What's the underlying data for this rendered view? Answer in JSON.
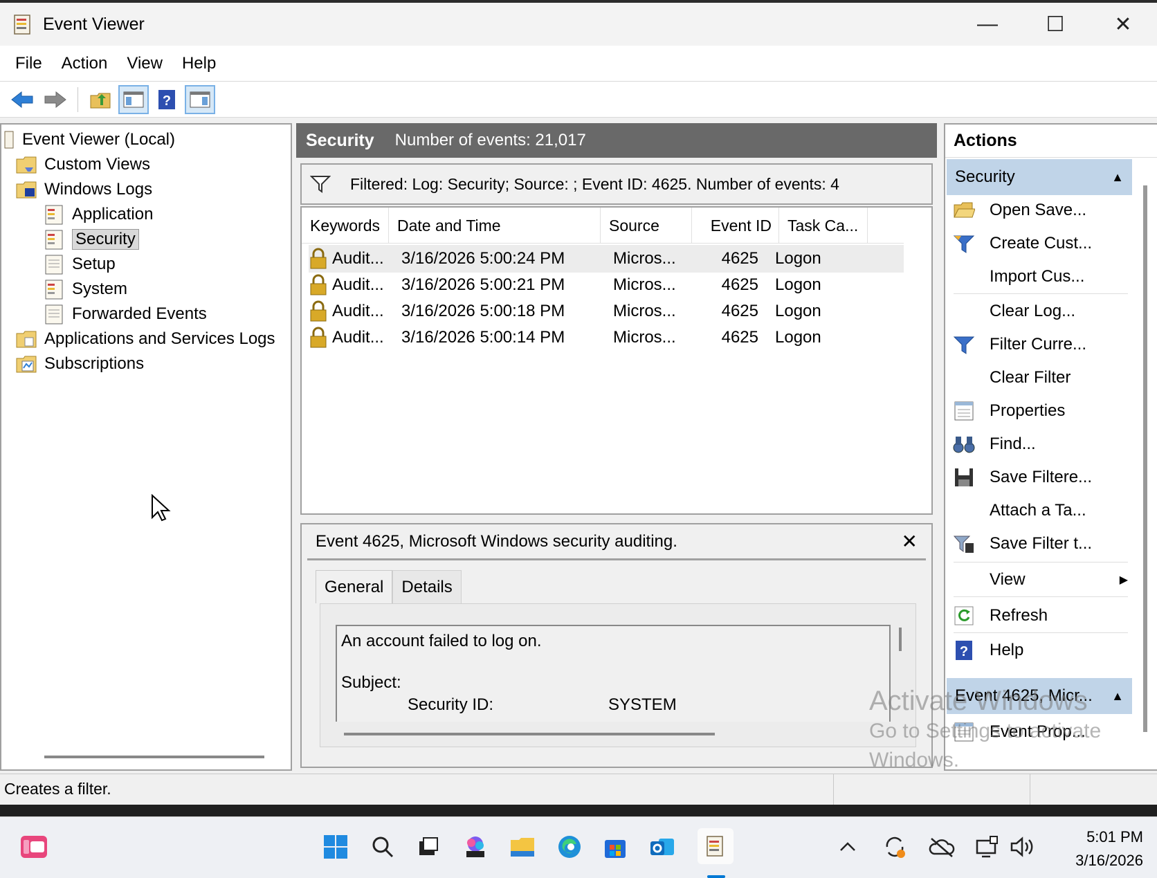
{
  "window": {
    "title": "Event Viewer",
    "controls": {
      "minimize": "—",
      "maximize": "☐",
      "close": "✕"
    }
  },
  "menu": [
    "File",
    "Action",
    "View",
    "Help"
  ],
  "toolbar": {
    "buttons": [
      "back-arrow-icon",
      "forward-arrow-icon",
      "up-folder-icon",
      "show-hide-console-tree-icon",
      "help-icon",
      "show-hide-action-pane-icon"
    ]
  },
  "tree": {
    "items": [
      {
        "label": "Event Viewer (Local)"
      },
      {
        "label": "Custom Views"
      },
      {
        "label": "Windows Logs"
      },
      {
        "label": "Application"
      },
      {
        "label": "Security"
      },
      {
        "label": "Setup"
      },
      {
        "label": "System"
      },
      {
        "label": "Forwarded Events"
      },
      {
        "label": "Applications and Services Logs"
      },
      {
        "label": "Subscriptions"
      }
    ]
  },
  "main": {
    "log_name": "Security",
    "event_count": "Number of events: 21,017",
    "filter_text": "Filtered: Log: Security; Source: ; Event ID: 4625. Number of events: 4",
    "columns": [
      "Keywords",
      "Date and Time",
      "Source",
      "Event ID",
      "Task Ca..."
    ],
    "rows": [
      {
        "keywords": "Audit...",
        "date": "3/16/2026 5:00:24 PM",
        "source": "Micros...",
        "event_id": "4625",
        "task": "Logon"
      },
      {
        "keywords": "Audit...",
        "date": "3/16/2026 5:00:21 PM",
        "source": "Micros...",
        "event_id": "4625",
        "task": "Logon"
      },
      {
        "keywords": "Audit...",
        "date": "3/16/2026 5:00:18 PM",
        "source": "Micros...",
        "event_id": "4625",
        "task": "Logon"
      },
      {
        "keywords": "Audit...",
        "date": "3/16/2026 5:00:14 PM",
        "source": "Micros...",
        "event_id": "4625",
        "task": "Logon"
      }
    ]
  },
  "detail": {
    "title": "Event 4625, Microsoft Windows security auditing.",
    "close": "✕",
    "tabs": [
      "General",
      "Details"
    ],
    "line1": "An account failed to log on.",
    "line2": "Subject:",
    "field_label": "Security ID:",
    "field_value": "SYSTEM"
  },
  "actions": {
    "title": "Actions",
    "section1": "Security",
    "items": [
      {
        "label": "Open Save...",
        "icon": "open-folder-icon"
      },
      {
        "label": "Create Cust...",
        "icon": "create-filter-icon"
      },
      {
        "label": "Import Cus...",
        "icon": ""
      },
      {
        "label": "Clear Log...",
        "icon": ""
      },
      {
        "label": "Filter Curre...",
        "icon": "filter-icon"
      },
      {
        "label": "Clear Filter",
        "icon": ""
      },
      {
        "label": "Properties",
        "icon": "properties-icon"
      },
      {
        "label": "Find...",
        "icon": "binoculars-icon"
      },
      {
        "label": "Save Filtere...",
        "icon": "save-icon"
      },
      {
        "label": "Attach a Ta...",
        "icon": ""
      },
      {
        "label": "Save Filter t...",
        "icon": "save-filter-icon"
      },
      {
        "label": "View",
        "icon": ""
      },
      {
        "label": "Refresh",
        "icon": "refresh-icon"
      },
      {
        "label": "Help",
        "icon": "help-icon"
      }
    ],
    "section2": "Event 4625, Micr...",
    "section2_items": [
      {
        "label": "Event Prop...",
        "icon": "event-properties-icon"
      }
    ]
  },
  "watermark": {
    "line1": "Activate Windows",
    "line2": "Go to Settings to activate",
    "line3": "Windows."
  },
  "status": "Creates a filter.",
  "taskbar": {
    "time": "5:01 PM",
    "date": "3/16/2026"
  },
  "colors": {
    "header_bg": "#696969",
    "section_bg": "#c0d4e8",
    "accent": "#0078d4"
  }
}
